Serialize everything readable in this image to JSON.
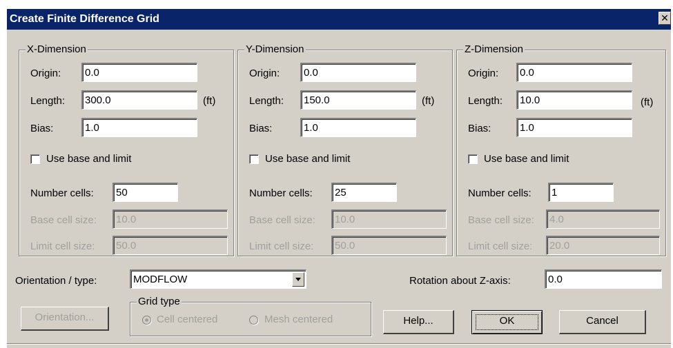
{
  "window": {
    "title": "Create Finite Difference Grid",
    "close_glyph": "✕"
  },
  "dimensions": {
    "x": {
      "legend": "X-Dimension",
      "origin_label": "Origin:",
      "origin_value": "0.0",
      "length_label": "Length:",
      "length_value": "300.0",
      "unit": "(ft)",
      "bias_label": "Bias:",
      "bias_value": "1.0",
      "base_limit_label": "Use base and limit",
      "cells_label": "Number cells:",
      "cells_value": "50",
      "base_label": "Base cell size:",
      "base_value": "10.0",
      "limit_label": "Limit cell size:",
      "limit_value": "50.0"
    },
    "y": {
      "legend": "Y-Dimension",
      "origin_label": "Origin:",
      "origin_value": "0.0",
      "length_label": "Length:",
      "length_value": "150.0",
      "unit": "(ft)",
      "bias_label": "Bias:",
      "bias_value": "1.0",
      "base_limit_label": "Use base and limit",
      "cells_label": "Number cells:",
      "cells_value": "25",
      "base_label": "Base cell size:",
      "base_value": "10.0",
      "limit_label": "Limit cell size:",
      "limit_value": "50.0"
    },
    "z": {
      "legend": "Z-Dimension",
      "origin_label": "Origin:",
      "origin_value": "0.0",
      "length_label": "Length:",
      "length_value": "10.0",
      "unit": "(ft)",
      "bias_label": "Bias:",
      "bias_value": "1.0",
      "base_limit_label": "Use base and limit",
      "cells_label": "Number cells:",
      "cells_value": "1",
      "base_label": "Base cell size:",
      "base_value": "4.0",
      "limit_label": "Limit cell size:",
      "limit_value": "20.0"
    }
  },
  "orientation": {
    "label": "Orientation / type:",
    "selected": "MODFLOW"
  },
  "rotation": {
    "label": "Rotation about Z-axis:",
    "value": "0.0"
  },
  "grid_type": {
    "legend": "Grid type",
    "cell_centered_label": "Cell centered",
    "mesh_centered_label": "Mesh centered"
  },
  "buttons": {
    "orientation": "Orientation...",
    "help": "Help...",
    "ok": "OK",
    "cancel": "Cancel"
  }
}
